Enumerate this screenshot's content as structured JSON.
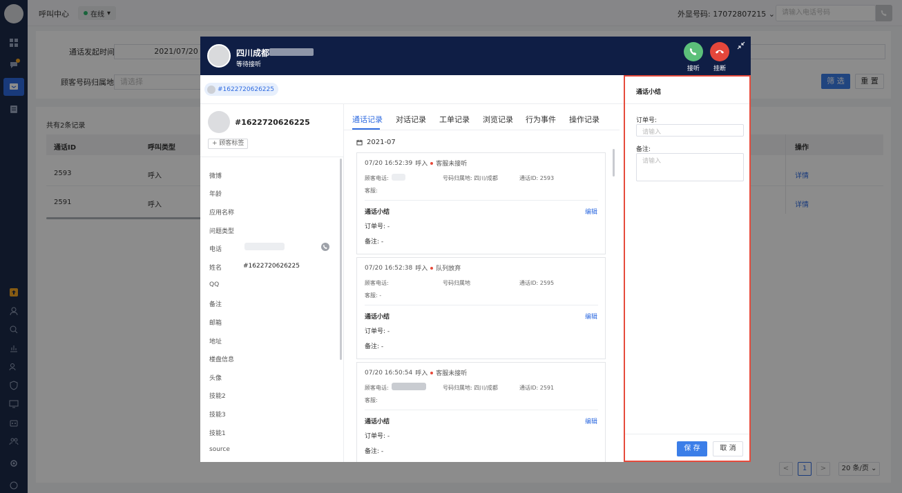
{
  "topbar": {
    "title": "呼叫中心",
    "status": "在线",
    "ext_label": "外显号码: 17072807215",
    "phone_placeholder": "请输入电话号码"
  },
  "filter": {
    "time_label": "通话发起时间:",
    "time_value": "2021/07/20",
    "region_label": "顾客号码归属地:",
    "region_placeholder": "请选择",
    "filter_button": "筛 选",
    "reset_button": "重 置"
  },
  "table": {
    "count": "共有2条记录",
    "headers": [
      "通话ID",
      "呼叫类型"
    ],
    "op_header": "操作",
    "rows": [
      {
        "id": "2593",
        "type": "呼入",
        "op": "详情"
      },
      {
        "id": "2591",
        "type": "呼入",
        "op": "详情"
      }
    ]
  },
  "pagination": {
    "prev": "<",
    "page": "1",
    "next": ">",
    "size": "20 条/页"
  },
  "modal": {
    "location": "四川成都",
    "status": "等待接听",
    "answer_label": "接听",
    "hangup_label": "挂断",
    "tag_chip": "#1622720626225",
    "profile": {
      "id": "#1622720626225",
      "tag_button": "+ 顾客标签",
      "fields": [
        {
          "label": "微博",
          "value": ""
        },
        {
          "label": "年龄",
          "value": ""
        },
        {
          "label": "应用名称",
          "value": ""
        },
        {
          "label": "问题类型",
          "value": ""
        },
        {
          "label": "电话",
          "value": ""
        },
        {
          "label": "姓名",
          "value": "#1622720626225"
        },
        {
          "label": "QQ",
          "value": ""
        },
        {
          "label": "备注",
          "value": ""
        },
        {
          "label": "邮箱",
          "value": ""
        },
        {
          "label": "地址",
          "value": ""
        },
        {
          "label": "楼盘信息",
          "value": ""
        },
        {
          "label": "头像",
          "value": ""
        },
        {
          "label": "技能2",
          "value": ""
        },
        {
          "label": "技能3",
          "value": ""
        },
        {
          "label": "技能1",
          "value": ""
        },
        {
          "label": "source",
          "value": ""
        }
      ]
    },
    "tabs": [
      "通话记录",
      "对话记录",
      "工单记录",
      "浏览记录",
      "行为事件",
      "操作记录"
    ],
    "month": "2021-07",
    "records": [
      {
        "time": "07/20 16:52:39",
        "type": "呼入",
        "state": "客服未接听",
        "customer_phone": "顾客电话:",
        "region": "号码归属地: 四川/成都",
        "call_id": "通话ID: 2593",
        "agent": "客服:",
        "summary_title": "通话小结",
        "edit": "编辑",
        "order": "订单号:  -",
        "note": "备注:  -"
      },
      {
        "time": "07/20 16:52:38",
        "type": "呼入",
        "state": "队列放弃",
        "customer_phone": "顾客电话:",
        "region": "号码归属地",
        "call_id": "通话ID: 2595",
        "agent": "客服: -",
        "summary_title": "通话小结",
        "edit": "编辑",
        "order": "订单号:  -",
        "note": "备注:  -"
      },
      {
        "time": "07/20 16:50:54",
        "type": "呼入",
        "state": "客服未接听",
        "customer_phone": "顾客电话:",
        "region": "号码归属地: 四川/成都",
        "call_id": "通话ID: 2591",
        "agent": "客服:",
        "summary_title": "通话小结",
        "edit": "编辑",
        "order": "订单号:  -",
        "note": "备注:  -"
      }
    ],
    "summary_panel": {
      "title": "通话小结",
      "order_label": "订单号:",
      "order_placeholder": "请输入",
      "note_label": "备注:",
      "note_placeholder": "请输入",
      "save": "保 存",
      "cancel": "取 消"
    }
  },
  "colors": {
    "primary": "#2f6be0",
    "header_bg": "#0f1e45",
    "answer": "#5cc07a",
    "hangup": "#e4473b",
    "highlight": "#e64a3b"
  }
}
